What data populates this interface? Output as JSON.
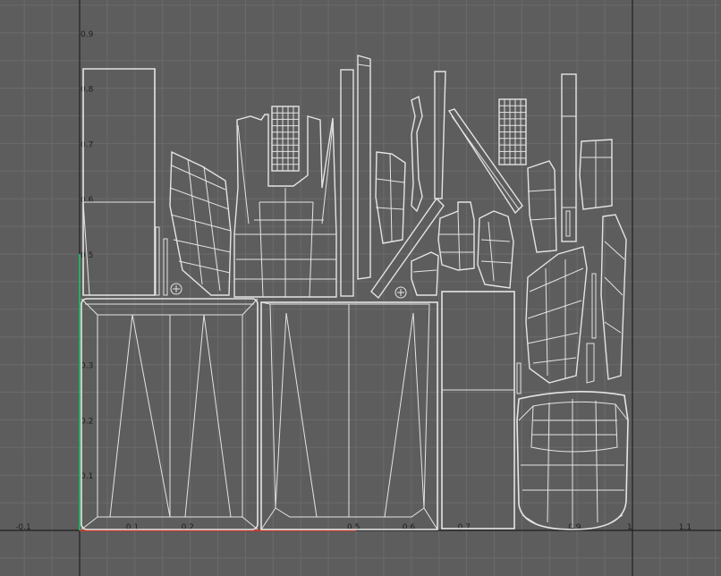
{
  "editor": {
    "panel": "uv-editor-viewport",
    "background_color": "#5d5d5d",
    "grid_color": "#6b6b6b",
    "axis_line_color": "#202020",
    "u_axis_color": "#c0392b",
    "v_axis_color": "#27ae60",
    "wire_color": "#e4e4e4"
  },
  "axis_labels": {
    "u": [
      "-0.1",
      "0.1",
      "0.2",
      "0.5",
      "0.6",
      "0.7",
      "0.9",
      "1",
      "1.1"
    ],
    "v": [
      "0.1",
      "0.2",
      "0.3",
      "0.5",
      "0.6",
      "0.7",
      "0.8",
      "0.9"
    ]
  },
  "uv_shells": [
    "tall-panel-top-left",
    "tall-panel-bottom-left",
    "curved-fin-left",
    "thin-strips-left",
    "bolt-left",
    "tower-shell-center",
    "grid-patch-center",
    "bottom-panel-center",
    "tall-strips-center",
    "small-fin-center",
    "hook-strip",
    "diagonal-strip",
    "mid-blocks",
    "bolt-center",
    "tall-box-right",
    "grid-patch-right",
    "right-fin-cluster",
    "seat-shell-bottom-right"
  ]
}
